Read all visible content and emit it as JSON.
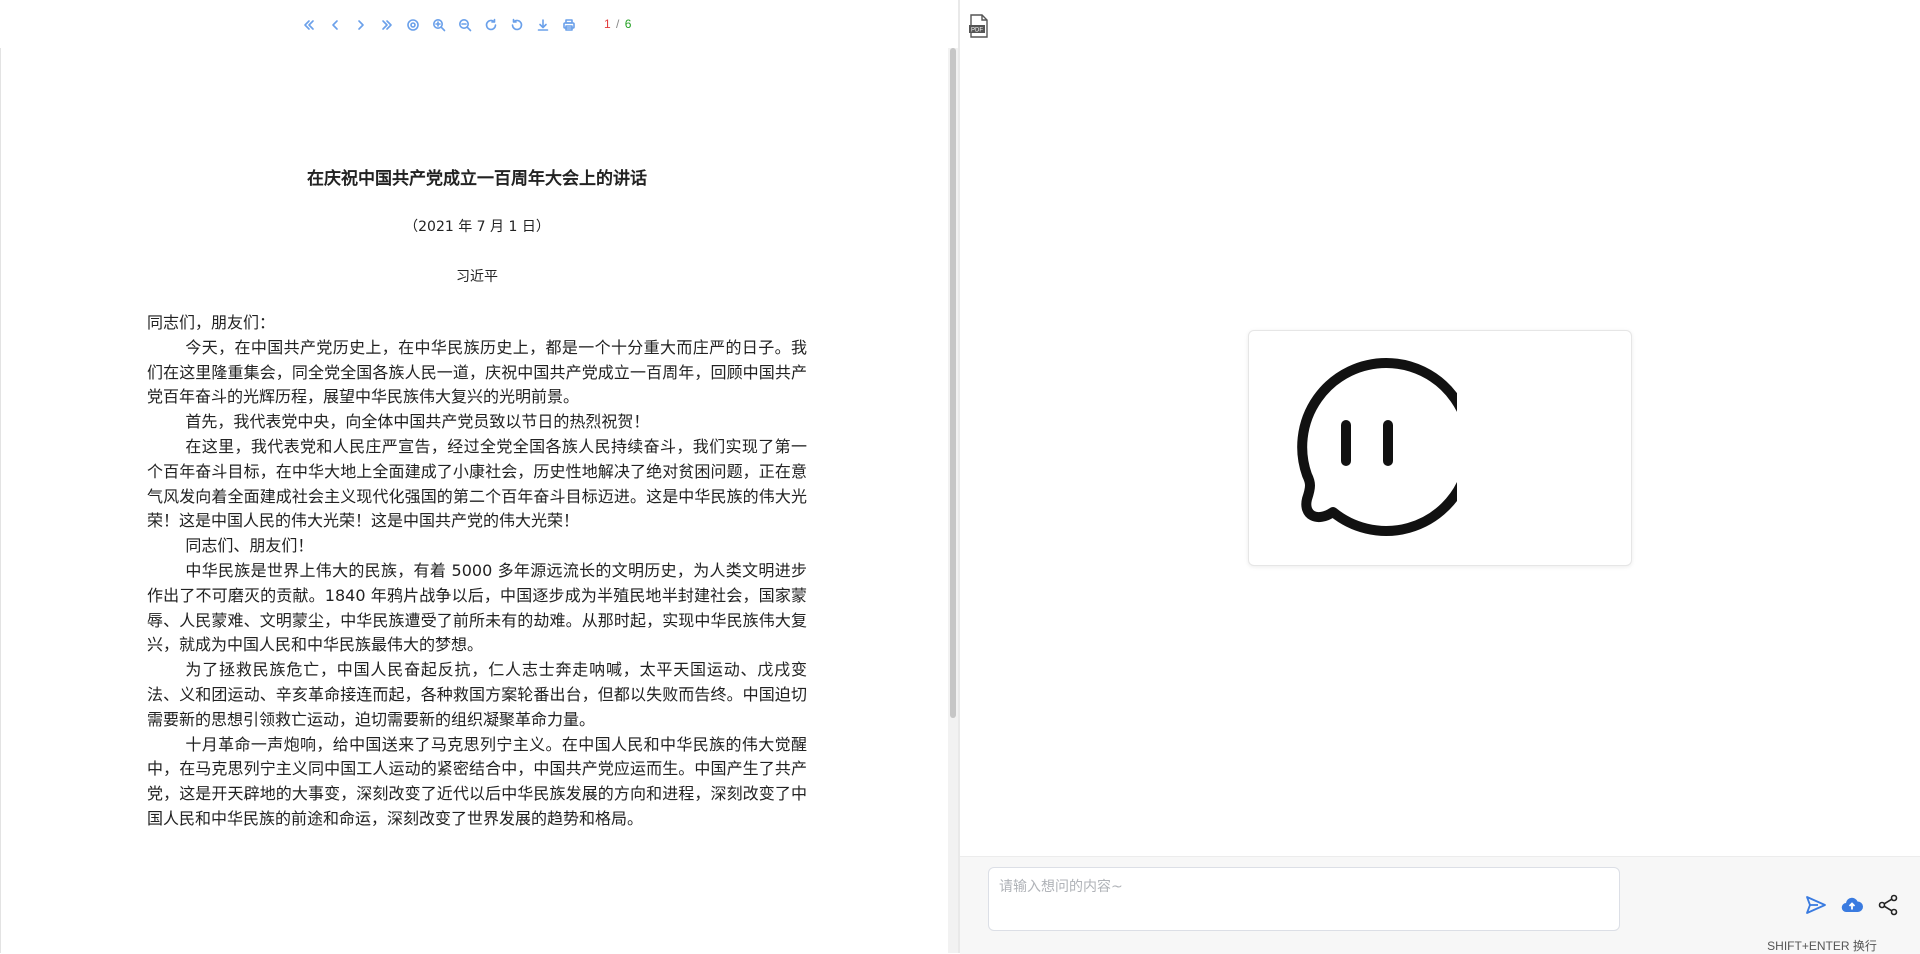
{
  "viewer": {
    "toolbar": {
      "icons": [
        "first-page-icon",
        "prev-page-icon",
        "next-page-icon",
        "last-page-icon",
        "fit-icon",
        "zoom-in-icon",
        "zoom-out-icon",
        "rotate-cw-icon",
        "rotate-ccw-icon",
        "download-icon",
        "print-icon"
      ],
      "current_page": "1",
      "separator": "/",
      "total_pages": "6",
      "colors": {
        "icon": "#6aa0ea",
        "current": "#e23b3b",
        "total": "#23a023"
      }
    },
    "document": {
      "title": "在庆祝中国共产党成立一百周年大会上的讲话",
      "date": "（2021 年 7 月 1 日）",
      "author": "习近平",
      "paragraphs": [
        "同志们，朋友们：",
        "今天，在中国共产党历史上，在中华民族历史上，都是一个十分重大而庄严的日子。我们在这里隆重集会，同全党全国各族人民一道，庆祝中国共产党成立一百周年，回顾中国共产党百年奋斗的光辉历程，展望中华民族伟大复兴的光明前景。",
        "首先，我代表党中央，向全体中国共产党员致以节日的热烈祝贺！",
        "在这里，我代表党和人民庄严宣告，经过全党全国各族人民持续奋斗，我们实现了第一个百年奋斗目标，在中华大地上全面建成了小康社会，历史性地解决了绝对贫困问题，正在意气风发向着全面建成社会主义现代化强国的第二个百年奋斗目标迈进。这是中华民族的伟大光荣！这是中国人民的伟大光荣！这是中国共产党的伟大光荣！",
        "同志们、朋友们！",
        "中华民族是世界上伟大的民族，有着 5000 多年源远流长的文明历史，为人类文明进步作出了不可磨灭的贡献。1840 年鸦片战争以后，中国逐步成为半殖民地半封建社会，国家蒙辱、人民蒙难、文明蒙尘，中华民族遭受了前所未有的劫难。从那时起，实现中华民族伟大复兴，就成为中国人民和中华民族最伟大的梦想。",
        "为了拯救民族危亡，中国人民奋起反抗，仁人志士奔走呐喊，太平天国运动、戊戌变法、义和团运动、辛亥革命接连而起，各种救国方案轮番出台，但都以失败而告终。中国迫切需要新的思想引领救亡运动，迫切需要新的组织凝聚革命力量。",
        "十月革命一声炮响，给中国送来了马克思列宁主义。在中国人民和中华民族的伟大觉醒中，在马克思列宁主义同中国工人运动的紧密结合中，中国共产党应运而生。中国产生了共产党，这是开天辟地的大事变，深刻改变了近代以后中华民族发展的方向和进程，深刻改变了中国人民和中华民族的前途和命运，深刻改变了世界发展的趋势和格局。"
      ]
    }
  },
  "chat": {
    "pdf_icon": "pdf-file-icon",
    "logo_icon": "chat-bubble-logo-icon",
    "input_placeholder": "请输入想问的内容~",
    "input_value": "",
    "send_icon": "send-icon",
    "upload_icon": "cloud-upload-icon",
    "share_icon": "share-icon",
    "hint": "SHIFT+ENTER 换行",
    "colors": {
      "accent": "#3a7be0"
    }
  }
}
